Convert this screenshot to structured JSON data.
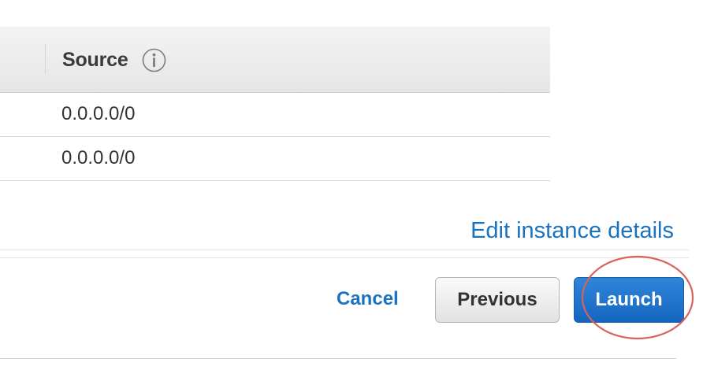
{
  "table": {
    "header": {
      "source_label": "Source"
    },
    "rows": [
      {
        "source": "0.0.0.0/0"
      },
      {
        "source": "0.0.0.0/0"
      }
    ]
  },
  "links": {
    "edit_instance_details": "Edit instance details"
  },
  "footer": {
    "cancel_label": "Cancel",
    "previous_label": "Previous",
    "launch_label": "Launch"
  },
  "icons": {
    "info": "info-icon"
  },
  "colors": {
    "link": "#1a73c1",
    "primary_button": "#1f76cc",
    "highlight_annotation": "#d9625a"
  }
}
